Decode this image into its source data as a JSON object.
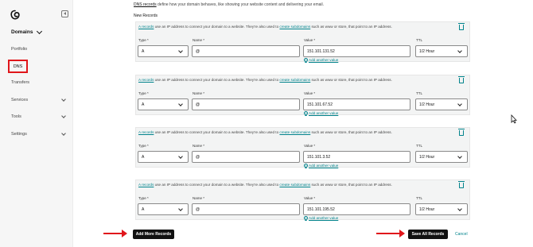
{
  "sidebar": {
    "logo_icon": "godaddy-logo-icon",
    "collapse_icon": "collapse-sidebar-icon",
    "domains_label": "Domains",
    "items": [
      {
        "label": "Portfolio"
      },
      {
        "label": "DNS"
      },
      {
        "label": "Transfers"
      },
      {
        "label": "Services"
      },
      {
        "label": "Tools"
      },
      {
        "label": "Settings"
      }
    ]
  },
  "main": {
    "intro_link": "DNS records",
    "intro_text": " define how your domain behaves, like showing your website content and delivering your email.",
    "section_title": "New Records",
    "desc": {
      "link1": "A records",
      "text1": " use an IP address to connect your domain to a website. They're also used to ",
      "link2": "create subdomains",
      "text2": " such as www or store, that point to an IP address."
    },
    "labels": {
      "type": "Type *",
      "name": "Name *",
      "value": "Value *",
      "ttl": "TTL"
    },
    "add_another": "Add another value",
    "records": [
      {
        "type": "A",
        "name": "@",
        "value": "151.101.131.52",
        "ttl": "1/2 Hour"
      },
      {
        "type": "A",
        "name": "@",
        "value": "151.101.67.52",
        "ttl": "1/2 Hour"
      },
      {
        "type": "A",
        "name": "@",
        "value": "151.101.3.52",
        "ttl": "1/2 Hour"
      },
      {
        "type": "A",
        "name": "@",
        "value": "151.101.195.52",
        "ttl": "1/2 Hour"
      }
    ]
  },
  "footer": {
    "add_more": "Add More Records",
    "save_all": "Save All Records",
    "cancel": "Cancel"
  },
  "colors": {
    "accent": "#00838c",
    "highlight": "#e0161b",
    "button": "#111111"
  }
}
